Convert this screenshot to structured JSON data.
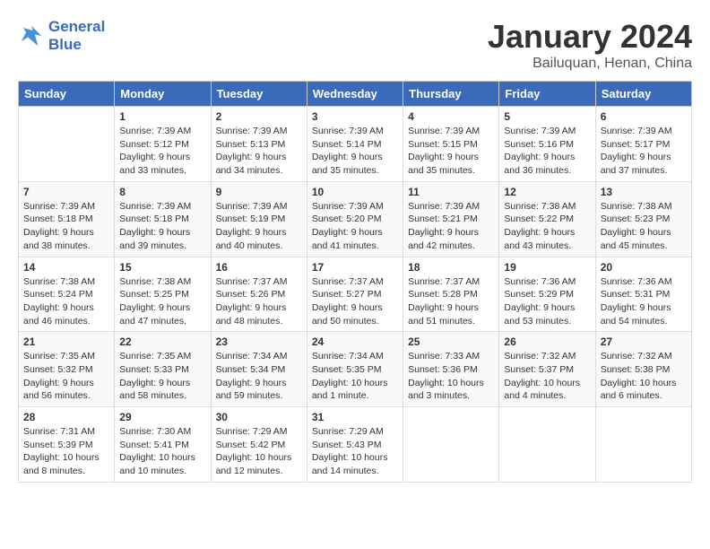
{
  "header": {
    "logo_line1": "General",
    "logo_line2": "Blue",
    "month": "January 2024",
    "location": "Bailuquan, Henan, China"
  },
  "days_of_week": [
    "Sunday",
    "Monday",
    "Tuesday",
    "Wednesday",
    "Thursday",
    "Friday",
    "Saturday"
  ],
  "weeks": [
    [
      {
        "day": "",
        "info": ""
      },
      {
        "day": "1",
        "info": "Sunrise: 7:39 AM\nSunset: 5:12 PM\nDaylight: 9 hours\nand 33 minutes."
      },
      {
        "day": "2",
        "info": "Sunrise: 7:39 AM\nSunset: 5:13 PM\nDaylight: 9 hours\nand 34 minutes."
      },
      {
        "day": "3",
        "info": "Sunrise: 7:39 AM\nSunset: 5:14 PM\nDaylight: 9 hours\nand 35 minutes."
      },
      {
        "day": "4",
        "info": "Sunrise: 7:39 AM\nSunset: 5:15 PM\nDaylight: 9 hours\nand 35 minutes."
      },
      {
        "day": "5",
        "info": "Sunrise: 7:39 AM\nSunset: 5:16 PM\nDaylight: 9 hours\nand 36 minutes."
      },
      {
        "day": "6",
        "info": "Sunrise: 7:39 AM\nSunset: 5:17 PM\nDaylight: 9 hours\nand 37 minutes."
      }
    ],
    [
      {
        "day": "7",
        "info": "Sunrise: 7:39 AM\nSunset: 5:18 PM\nDaylight: 9 hours\nand 38 minutes."
      },
      {
        "day": "8",
        "info": "Sunrise: 7:39 AM\nSunset: 5:18 PM\nDaylight: 9 hours\nand 39 minutes."
      },
      {
        "day": "9",
        "info": "Sunrise: 7:39 AM\nSunset: 5:19 PM\nDaylight: 9 hours\nand 40 minutes."
      },
      {
        "day": "10",
        "info": "Sunrise: 7:39 AM\nSunset: 5:20 PM\nDaylight: 9 hours\nand 41 minutes."
      },
      {
        "day": "11",
        "info": "Sunrise: 7:39 AM\nSunset: 5:21 PM\nDaylight: 9 hours\nand 42 minutes."
      },
      {
        "day": "12",
        "info": "Sunrise: 7:38 AM\nSunset: 5:22 PM\nDaylight: 9 hours\nand 43 minutes."
      },
      {
        "day": "13",
        "info": "Sunrise: 7:38 AM\nSunset: 5:23 PM\nDaylight: 9 hours\nand 45 minutes."
      }
    ],
    [
      {
        "day": "14",
        "info": "Sunrise: 7:38 AM\nSunset: 5:24 PM\nDaylight: 9 hours\nand 46 minutes."
      },
      {
        "day": "15",
        "info": "Sunrise: 7:38 AM\nSunset: 5:25 PM\nDaylight: 9 hours\nand 47 minutes."
      },
      {
        "day": "16",
        "info": "Sunrise: 7:37 AM\nSunset: 5:26 PM\nDaylight: 9 hours\nand 48 minutes."
      },
      {
        "day": "17",
        "info": "Sunrise: 7:37 AM\nSunset: 5:27 PM\nDaylight: 9 hours\nand 50 minutes."
      },
      {
        "day": "18",
        "info": "Sunrise: 7:37 AM\nSunset: 5:28 PM\nDaylight: 9 hours\nand 51 minutes."
      },
      {
        "day": "19",
        "info": "Sunrise: 7:36 AM\nSunset: 5:29 PM\nDaylight: 9 hours\nand 53 minutes."
      },
      {
        "day": "20",
        "info": "Sunrise: 7:36 AM\nSunset: 5:31 PM\nDaylight: 9 hours\nand 54 minutes."
      }
    ],
    [
      {
        "day": "21",
        "info": "Sunrise: 7:35 AM\nSunset: 5:32 PM\nDaylight: 9 hours\nand 56 minutes."
      },
      {
        "day": "22",
        "info": "Sunrise: 7:35 AM\nSunset: 5:33 PM\nDaylight: 9 hours\nand 58 minutes."
      },
      {
        "day": "23",
        "info": "Sunrise: 7:34 AM\nSunset: 5:34 PM\nDaylight: 9 hours\nand 59 minutes."
      },
      {
        "day": "24",
        "info": "Sunrise: 7:34 AM\nSunset: 5:35 PM\nDaylight: 10 hours\nand 1 minute."
      },
      {
        "day": "25",
        "info": "Sunrise: 7:33 AM\nSunset: 5:36 PM\nDaylight: 10 hours\nand 3 minutes."
      },
      {
        "day": "26",
        "info": "Sunrise: 7:32 AM\nSunset: 5:37 PM\nDaylight: 10 hours\nand 4 minutes."
      },
      {
        "day": "27",
        "info": "Sunrise: 7:32 AM\nSunset: 5:38 PM\nDaylight: 10 hours\nand 6 minutes."
      }
    ],
    [
      {
        "day": "28",
        "info": "Sunrise: 7:31 AM\nSunset: 5:39 PM\nDaylight: 10 hours\nand 8 minutes."
      },
      {
        "day": "29",
        "info": "Sunrise: 7:30 AM\nSunset: 5:41 PM\nDaylight: 10 hours\nand 10 minutes."
      },
      {
        "day": "30",
        "info": "Sunrise: 7:29 AM\nSunset: 5:42 PM\nDaylight: 10 hours\nand 12 minutes."
      },
      {
        "day": "31",
        "info": "Sunrise: 7:29 AM\nSunset: 5:43 PM\nDaylight: 10 hours\nand 14 minutes."
      },
      {
        "day": "",
        "info": ""
      },
      {
        "day": "",
        "info": ""
      },
      {
        "day": "",
        "info": ""
      }
    ]
  ]
}
